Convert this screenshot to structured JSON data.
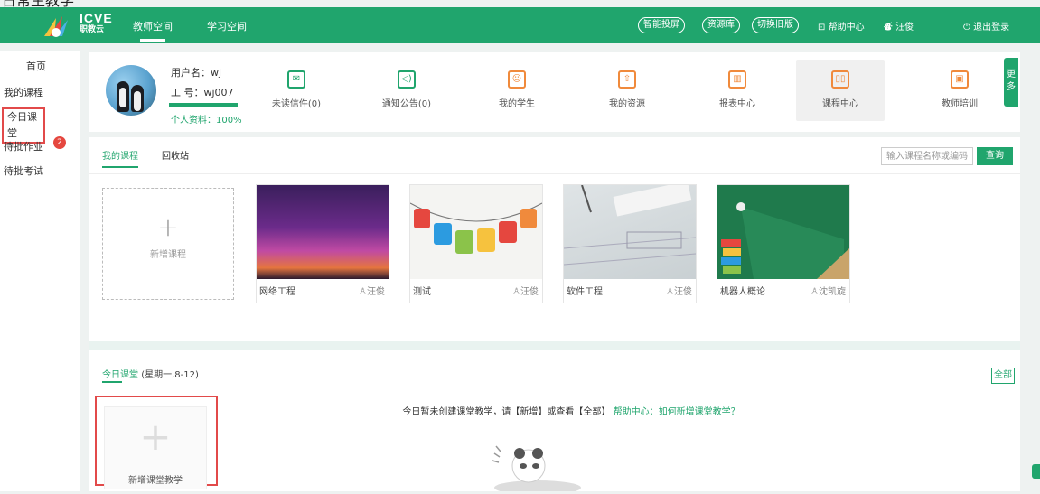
{
  "caption": "日常生教学",
  "header": {
    "brand_title": "ICVE",
    "brand_sub": "职教云",
    "nav": [
      {
        "label": "教师空间"
      },
      {
        "label": "学习空间"
      }
    ],
    "pills": [
      {
        "label": "智能投屏"
      },
      {
        "label": "资源库"
      },
      {
        "label": "切换旧版"
      }
    ],
    "help": "帮助中心",
    "user": "汪俊",
    "logout": "退出登录"
  },
  "sidebar": {
    "items": [
      {
        "label": "首页"
      },
      {
        "label": "我的课程"
      },
      {
        "label": "今日课堂"
      },
      {
        "label": "待批作业"
      },
      {
        "label": "待批考试"
      }
    ],
    "homework_badge": "2"
  },
  "profile": {
    "username_label": "用户名：",
    "username": "wj",
    "id_label": "工  号：",
    "id": "wj007",
    "completion": "个人资料：100%",
    "completion_value": 100
  },
  "menu": {
    "items": [
      {
        "label": "未读信件(0)",
        "glyph": "✉",
        "icon": "envelope-icon"
      },
      {
        "label": "通知公告(0)",
        "glyph": "◁)",
        "icon": "speaker-icon"
      },
      {
        "label": "我的学生",
        "glyph": "☺",
        "icon": "student-icon"
      },
      {
        "label": "我的资源",
        "glyph": "⇧",
        "icon": "upload-icon"
      },
      {
        "label": "报表中心",
        "glyph": "▥",
        "icon": "bar-chart-icon"
      },
      {
        "label": "课程中心",
        "glyph": "▯▯",
        "icon": "books-icon"
      },
      {
        "label": "教师培训",
        "glyph": "▣",
        "icon": "presentation-icon"
      }
    ],
    "more": "更多"
  },
  "courses": {
    "tabs": [
      {
        "label": "我的课程"
      },
      {
        "label": "回收站"
      }
    ],
    "search_placeholder": "输入课程名称或编码",
    "search_button": "查询",
    "add_label": "新增课程",
    "items": [
      {
        "name": "网络工程",
        "teacher": "汪俊"
      },
      {
        "name": "测试",
        "teacher": "汪俊"
      },
      {
        "name": "软件工程",
        "teacher": "汪俊"
      },
      {
        "name": "机器人概论",
        "teacher": "沈凯旋"
      }
    ]
  },
  "today": {
    "title": "今日课堂",
    "date": "(星期一,8-12)",
    "all_button": "全部",
    "message_pre": "今日暂未创建课堂教学，请【新增】或查看【全部】",
    "message_link": "帮助中心：如何新增课堂教学？",
    "new_label": "新增课堂教学"
  },
  "colors": {
    "accent": "#20a56d",
    "highlight": "#e24a4a"
  }
}
